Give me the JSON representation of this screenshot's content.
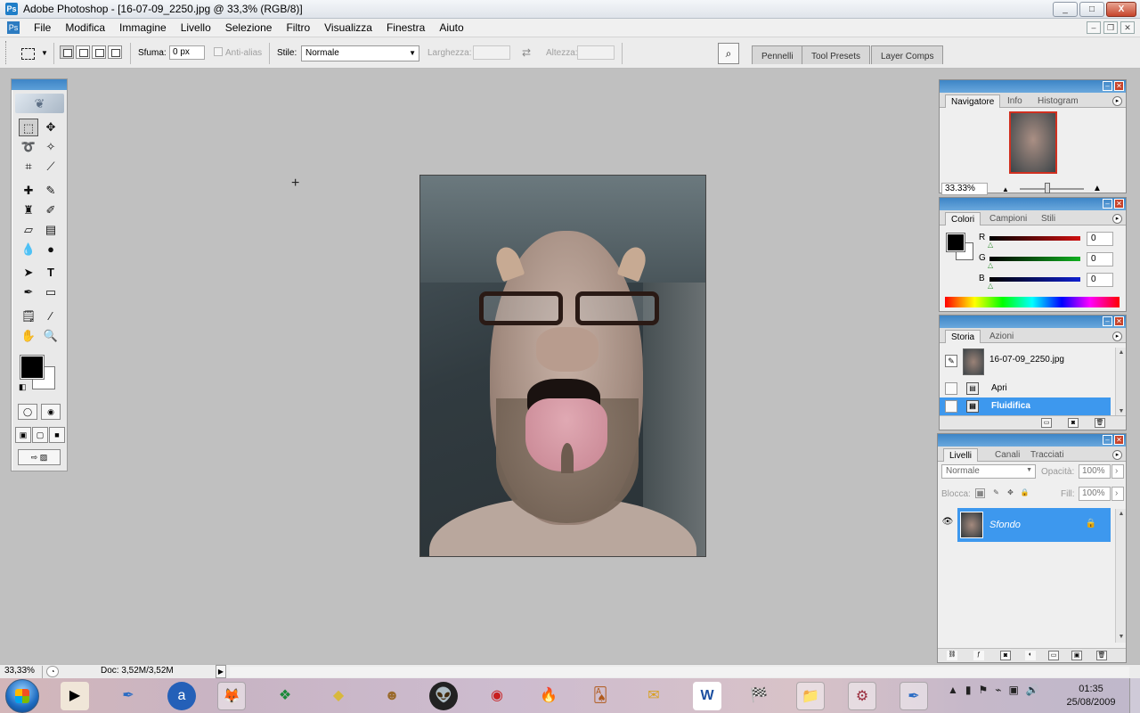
{
  "window": {
    "title": "Adobe Photoshop - [16-07-09_2250.jpg @ 33,3% (RGB/8)]",
    "controls": [
      "_",
      "□",
      "X"
    ]
  },
  "menu": {
    "items": [
      "File",
      "Modifica",
      "Immagine",
      "Livello",
      "Selezione",
      "Filtro",
      "Visualizza",
      "Finestra",
      "Aiuto"
    ]
  },
  "options": {
    "feather_label": "Sfuma:",
    "feather_value": "0 px",
    "antialias_label": "Anti-alias",
    "style_label": "Stile:",
    "style_value": "Normale",
    "width_label": "Larghezza:",
    "height_label": "Altezza:"
  },
  "palette_well": {
    "tabs": [
      "Pennelli",
      "Tool Presets",
      "Layer Comps"
    ]
  },
  "navigator": {
    "tabs": [
      "Navigatore",
      "Info",
      "Histogram"
    ],
    "zoom": "33.33%"
  },
  "colors": {
    "tabs": [
      "Colori",
      "Campioni",
      "Stili"
    ],
    "channels": [
      {
        "label": "R",
        "value": "0",
        "bar_color": "#d01010"
      },
      {
        "label": "G",
        "value": "0",
        "bar_color": "#10b020"
      },
      {
        "label": "B",
        "value": "0",
        "bar_color": "#1020d0"
      }
    ],
    "foreground": "#000000",
    "background": "#ffffff"
  },
  "history": {
    "tabs": [
      "Storia",
      "Azioni"
    ],
    "snapshot": "16-07-09_2250.jpg",
    "steps": [
      {
        "label": "Apri",
        "selected": false
      },
      {
        "label": "Fluidifica",
        "selected": true
      }
    ]
  },
  "layers": {
    "tabs": [
      "Livelli",
      "Canali",
      "Tracciati"
    ],
    "blend_mode": "Normale",
    "opacity_label": "Opacità:",
    "opacity": "100%",
    "lock_label": "Blocca:",
    "fill_label": "Fill:",
    "fill": "100%",
    "items": [
      {
        "name": "Sfondo",
        "locked": true,
        "visible": true
      }
    ]
  },
  "status": {
    "zoom": "33,33%",
    "doc_info": "Doc: 3,52M/3,52M"
  },
  "taskbar": {
    "clock_time": "01:35",
    "clock_date": "25/08/2009"
  }
}
